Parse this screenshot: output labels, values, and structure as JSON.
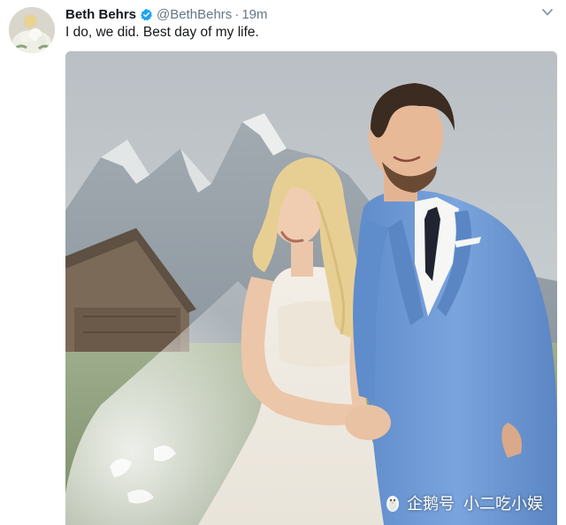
{
  "tweet": {
    "display_name": "Beth Behrs",
    "handle": "@BethBehrs",
    "separator": "·",
    "time": "19m",
    "text": "I do, we did. Best day of my life.",
    "verified_icon": "verified-badge-icon",
    "caret_icon": "chevron-down-icon"
  },
  "watermark": {
    "brand": "企鹅号",
    "account": "小二吃小娱",
    "logo_icon": "penguin-logo-icon"
  },
  "colors": {
    "name": "#14171a",
    "secondary_text": "#657786",
    "verified_blue": "#1da1f2",
    "suit_blue": "#6f9bd6"
  }
}
